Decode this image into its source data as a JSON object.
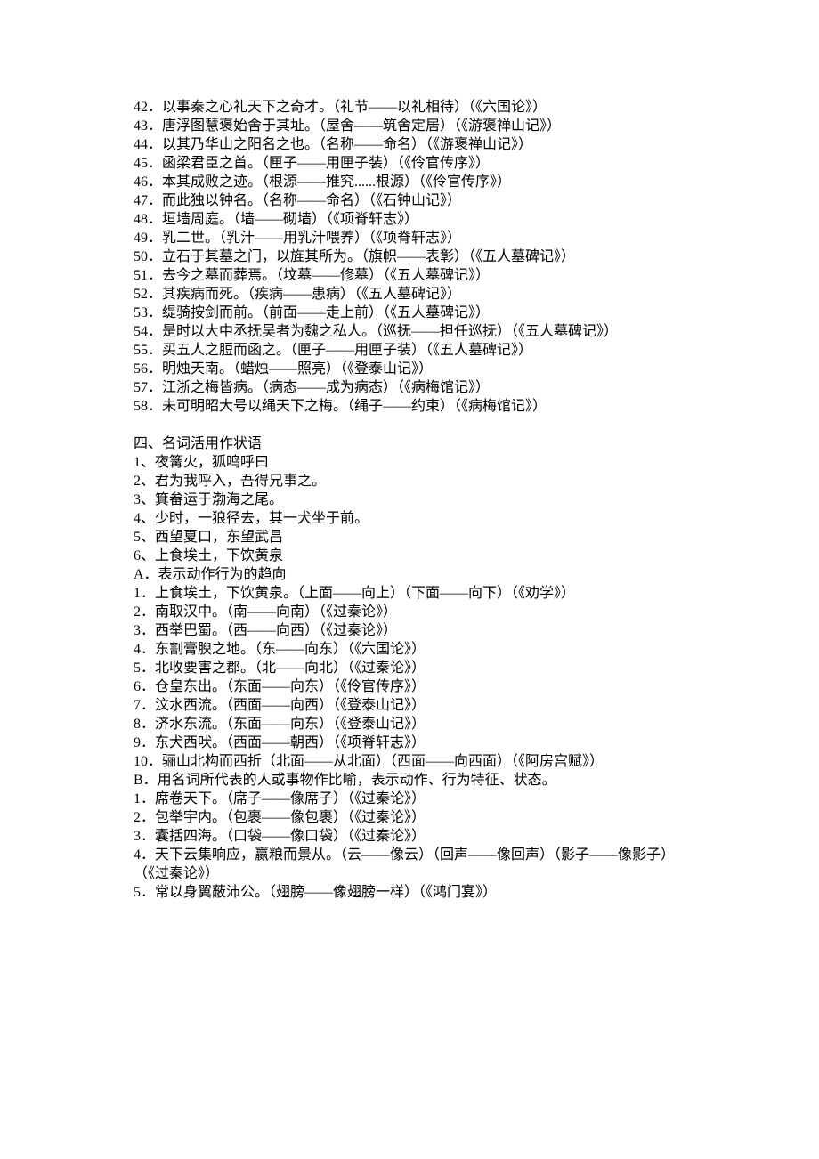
{
  "block1": {
    "items": [
      "42．以事秦之心礼天下之奇才。（礼节——以礼相待）（《六国论》）",
      "43．唐浮图慧褒始舍于其址。（屋舍——筑舍定居）（《游褒禅山记》）",
      "44．以其乃华山之阳名之也。（名称——命名）（《游褒禅山记》）",
      "45．函梁君臣之首。（匣子——用匣子装）（《伶官传序》）",
      "46．本其成败之迹。（根源——推究......根源）（《伶官传序》）",
      "47．而此独以钟名。（名称——命名）（《石钟山记》）",
      "48．垣墙周庭。（墙——砌墙）（《项脊轩志》）",
      "49．乳二世。（乳汁——用乳汁喂养）（《项脊轩志》）",
      "50．立石于其墓之门，以旌其所为。（旗帜——表彰）（《五人墓碑记》）",
      "51．去今之墓而葬焉。（坟墓——修墓）（《五人墓碑记》）",
      "52．其疾病而死。（疾病——患病）（《五人墓碑记》）",
      "53．缇骑按剑而前。（前面——走上前）（《五人墓碑记》）",
      "54．是时以大中丞抚吴者为魏之私人。（巡抚——担任巡抚）（《五人墓碑记》）",
      "55．买五人之脰而函之。（匣子——用匣子装）（《五人墓碑记》）",
      "56．明烛天南。（蜡烛——照亮）（《登泰山记》）",
      "57．江浙之梅皆病。（病态——成为病态）（《病梅馆记》）",
      "58．未可明昭大号以绳天下之梅。（绳子——约束）（《病梅馆记》）"
    ]
  },
  "section4": {
    "title": "四、名词活用作状语",
    "examples": [
      "1、夜篝火，狐鸣呼曰",
      "2、君为我呼入，吾得兄事之。",
      "3、箕畚运于渤海之尾。",
      "4、少时，一狼径去，其一犬坐于前。",
      "5、西望夏口，东望武昌",
      "6、上食埃土，下饮黄泉"
    ]
  },
  "groupA": {
    "header": " A．表示动作行为的趋向",
    "items": [
      "1．上食埃土，下饮黄泉。（上面——向上）（下面——向下）（《劝学》）",
      "2．南取汉中。（南——向南）（《过秦论》）",
      "3．西举巴蜀。（西——向西）（《过秦论》）",
      "4．东割膏腴之地。（东——向东）（《六国论》）",
      "5．北收要害之郡。（北——向北）（《过秦论》）",
      "6．仓皇东出。（东面——向东）（《伶官传序》）",
      "7．汶水西流。（西面——向西）（《登泰山记》）",
      "8．济水东流。（东面——向东）（《登泰山记》）",
      "9．东犬西吠。（西面——朝西）（《项脊轩志》）",
      "10．骊山北构而西折（北面——从北面）（西面——向西面）（《阿房宫赋》）"
    ]
  },
  "groupB": {
    "header": "  B．用名词所代表的人或事物作比喻，表示动作、行为特征、状态。",
    "items": [
      "1．席卷天下。（席子——像席子）（《过秦论》）",
      "2．包举宇内。（包裹——像包裹）（《过秦论》）",
      "3．囊括四海。（口袋——像口袋）（《过秦论》）",
      "4．天下云集响应，赢粮而景从。（云——像云）（回声——像回声）（影子——像影子）",
      "（《过秦论》）",
      "5．常以身翼蔽沛公。（翅膀——像翅膀一样）（《鸿门宴》）"
    ]
  }
}
